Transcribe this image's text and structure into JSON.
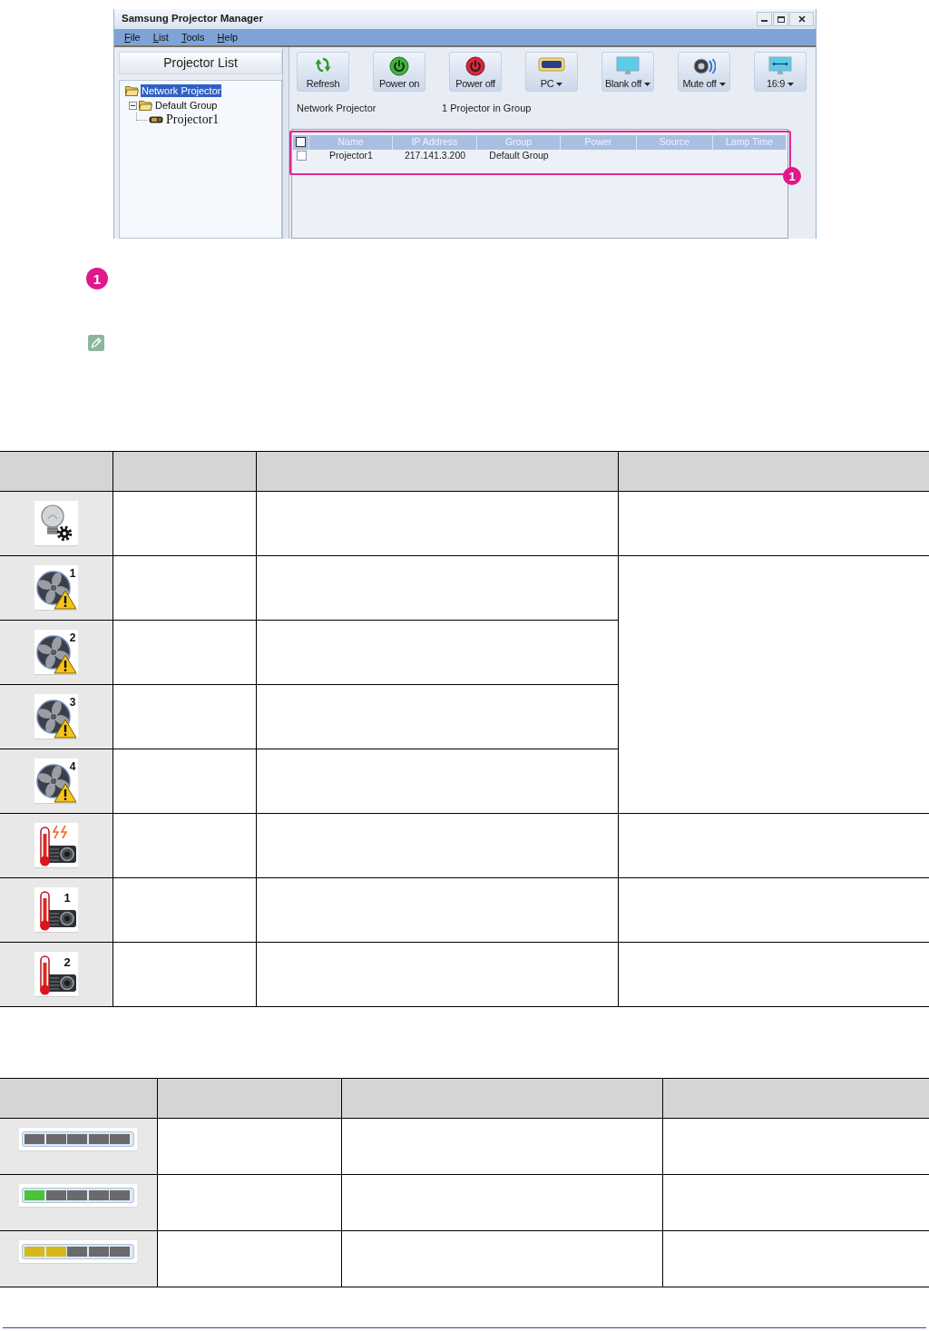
{
  "window": {
    "title": "Samsung Projector Manager"
  },
  "menu": [
    "File",
    "List",
    "Tools",
    "Help"
  ],
  "sidebar": {
    "title": "Projector List",
    "tree": [
      {
        "label": "Network Projector",
        "kind": "folder",
        "selected": true,
        "children": [
          {
            "label": "Default Group",
            "kind": "folder",
            "selected": false,
            "expanded": true,
            "children": [
              {
                "label": "Projector1",
                "kind": "projector",
                "selected": false
              }
            ]
          }
        ]
      }
    ]
  },
  "toolbar": [
    {
      "label": "Refresh",
      "kind": "refresh",
      "dropdown": false
    },
    {
      "label": "Power on",
      "kind": "power_on",
      "dropdown": false
    },
    {
      "label": "Power off",
      "kind": "power_off",
      "dropdown": false
    },
    {
      "label": "PC",
      "kind": "source",
      "dropdown": true
    },
    {
      "label": "Blank off",
      "kind": "blank",
      "dropdown": true
    },
    {
      "label": "Mute off",
      "kind": "mute",
      "dropdown": true
    },
    {
      "label": "16:9",
      "kind": "aspect",
      "dropdown": true
    }
  ],
  "status_line": {
    "location": "Network Projector",
    "count": "1 Projector in Group"
  },
  "projector_table": {
    "select_all_checked": false,
    "columns": [
      "Name",
      "IP Address",
      "Group",
      "Power",
      "Source",
      "Lamp Time"
    ],
    "rows": [
      {
        "checked": false,
        "cells": [
          "Projector1",
          "217.141.3.200",
          "Default Group"
        ]
      }
    ]
  },
  "callout": {
    "marker": "1"
  },
  "legend": {
    "marker": "1"
  },
  "icon_table": {
    "groups": [
      {
        "rows": [
          {
            "kind": "lamp_gear"
          }
        ]
      },
      {
        "rows": [
          {
            "kind": "fan_warning",
            "number": "1"
          },
          {
            "kind": "fan_warning",
            "number": "2"
          },
          {
            "kind": "fan_warning",
            "number": "3"
          },
          {
            "kind": "fan_warning",
            "number": "4"
          }
        ]
      },
      {
        "rows": [
          {
            "kind": "overheat_sparks"
          }
        ]
      },
      {
        "rows": [
          {
            "kind": "overheat",
            "number": "1"
          }
        ]
      },
      {
        "rows": [
          {
            "kind": "overheat",
            "number": "2"
          }
        ]
      }
    ]
  },
  "meter_table": {
    "rows": [
      {
        "level": 0
      },
      {
        "level": 0.2,
        "color": "#4cc334"
      },
      {
        "level": 0.4,
        "color": "#d6b81a"
      }
    ]
  }
}
